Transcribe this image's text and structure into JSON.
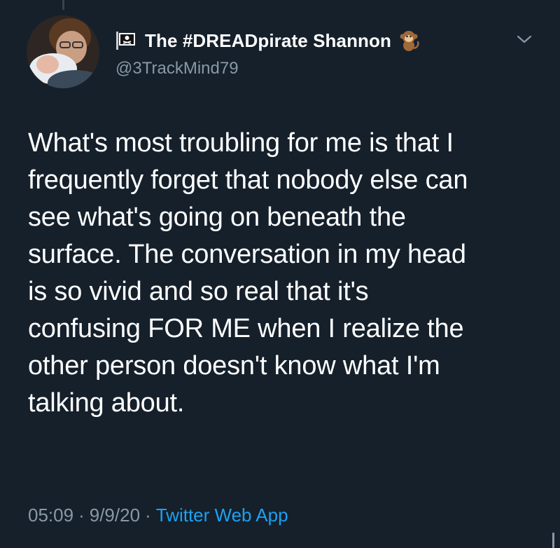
{
  "tweet": {
    "author": {
      "display_name": "The #DREADpirate Shannon",
      "handle": "@3TrackMind79",
      "name_prefix_icon": "pirate-flag-icon",
      "name_suffix_icon": "monkey-emoji-icon"
    },
    "text_lines": [
      "What's most troubling for me is that I",
      "frequently forget that nobody else can",
      "see what's going on beneath the",
      "surface. The conversation in my head",
      "is so vivid and so real that it's",
      "confusing FOR ME when I realize the",
      "other person doesn't know what I'm",
      "talking about."
    ],
    "time": "05:09",
    "date": "9/9/20",
    "separator": "·",
    "source": "Twitter Web App",
    "menu_icon": "chevron-down-icon"
  },
  "colors": {
    "background": "#15202b",
    "text": "#ffffff",
    "secondary_text": "#8899a6",
    "link": "#1da1f2"
  }
}
